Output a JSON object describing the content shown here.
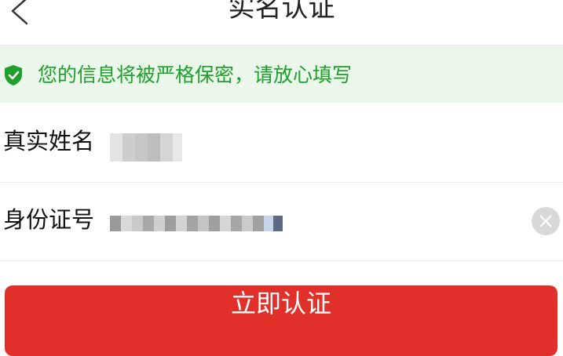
{
  "header": {
    "title": "实名认证"
  },
  "notice": {
    "text": "您的信息将被严格保密，请放心填写"
  },
  "form": {
    "name_label": "真实姓名",
    "id_label": "身份证号"
  },
  "submit": {
    "label": "立即认证"
  },
  "colors": {
    "accent_red": "#e1302a",
    "notice_green": "#1fa02c",
    "notice_bg": "#eaf7ea"
  }
}
